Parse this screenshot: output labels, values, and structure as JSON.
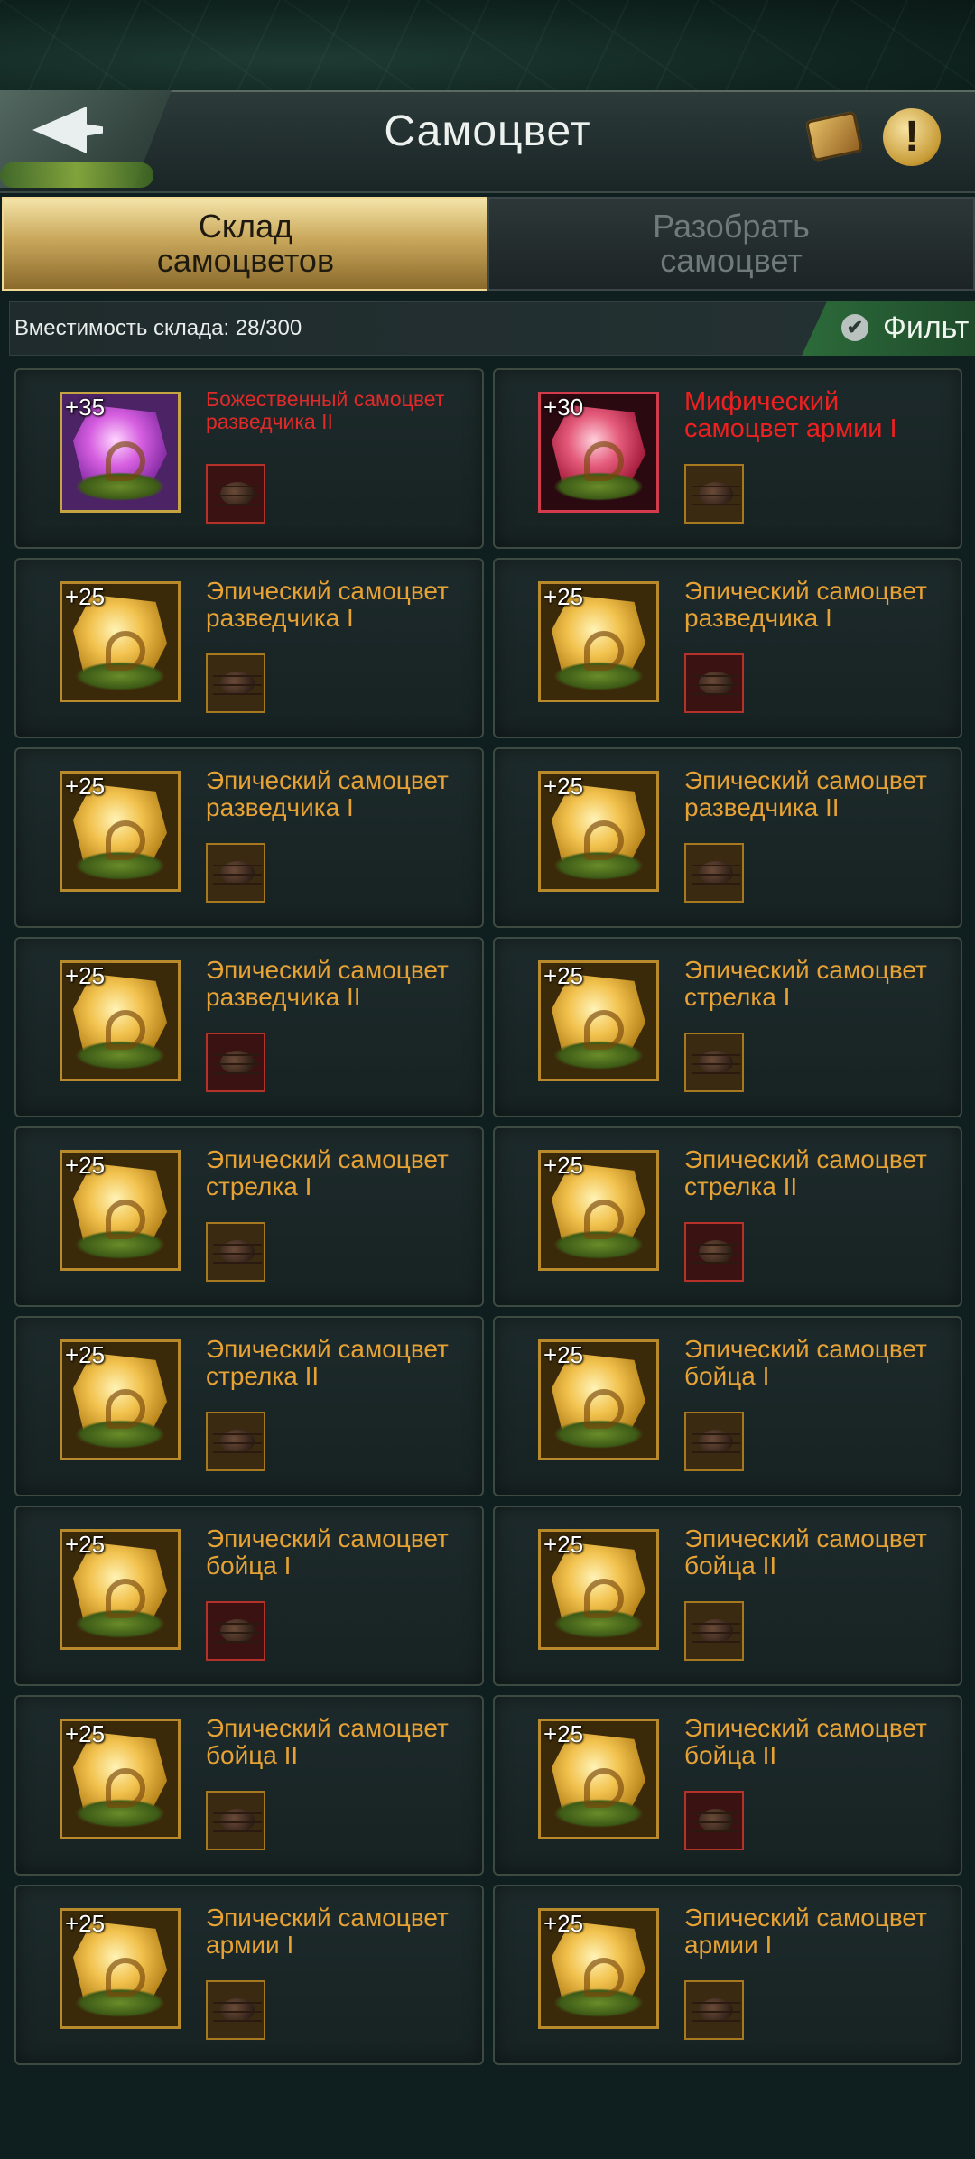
{
  "header": {
    "title": "Самоцвет",
    "back_icon": "back-arrow-icon",
    "book_icon": "gem-book-icon",
    "info_icon": "info-icon",
    "info_glyph": "!"
  },
  "tabs": {
    "storage_label": "Склад самоцветов",
    "disassemble_label": "Разобрать самоцвет"
  },
  "capacity": {
    "text": "Вместимость склада: 28/300"
  },
  "filter": {
    "label": "Фильт",
    "check_glyph": "✔"
  },
  "gems": [
    {
      "bonus": "+35",
      "name": "Божественный самоцвет разведчика II",
      "rarity": "divine"
    },
    {
      "bonus": "+30",
      "name": "Мифический самоцвет армии I",
      "rarity": "mythic"
    },
    {
      "bonus": "+25",
      "name": "Эпический самоцвет разведчика I",
      "rarity": "epic"
    },
    {
      "bonus": "+25",
      "name": "Эпический самоцвет разведчика I",
      "rarity": "epic"
    },
    {
      "bonus": "+25",
      "name": "Эпический самоцвет разведчика I",
      "rarity": "epic"
    },
    {
      "bonus": "+25",
      "name": "Эпический самоцвет разведчика II",
      "rarity": "epic"
    },
    {
      "bonus": "+25",
      "name": "Эпический самоцвет разведчика II",
      "rarity": "epic"
    },
    {
      "bonus": "+25",
      "name": "Эпический самоцвет стрелка I",
      "rarity": "epic"
    },
    {
      "bonus": "+25",
      "name": "Эпический самоцвет стрелка I",
      "rarity": "epic"
    },
    {
      "bonus": "+25",
      "name": "Эпический самоцвет стрелка II",
      "rarity": "epic"
    },
    {
      "bonus": "+25",
      "name": "Эпический самоцвет стрелка II",
      "rarity": "epic"
    },
    {
      "bonus": "+25",
      "name": "Эпический самоцвет бойца I",
      "rarity": "epic"
    },
    {
      "bonus": "+25",
      "name": "Эпический самоцвет бойца I",
      "rarity": "epic"
    },
    {
      "bonus": "+25",
      "name": "Эпический самоцвет бойца II",
      "rarity": "epic"
    },
    {
      "bonus": "+25",
      "name": "Эпический самоцвет бойца II",
      "rarity": "epic"
    },
    {
      "bonus": "+25",
      "name": "Эпический самоцвет бойца II",
      "rarity": "epic"
    },
    {
      "bonus": "+25",
      "name": "Эпический самоцвет армии I",
      "rarity": "epic"
    },
    {
      "bonus": "+25",
      "name": "Эпический самоцвет армии I",
      "rarity": "epic"
    }
  ],
  "colors": {
    "epic": "#e6a234",
    "mythic": "#ee2020",
    "divine": "#e02a2a",
    "tab_active": "#c9a75b",
    "filter": "#2c6b3a"
  }
}
